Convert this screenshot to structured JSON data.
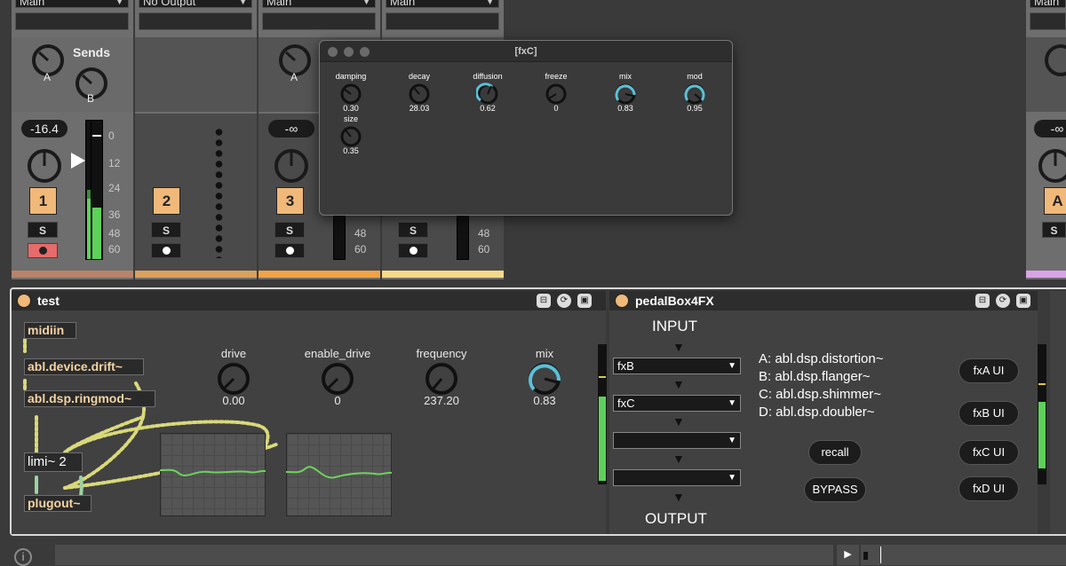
{
  "mixer": {
    "tracks": [
      {
        "output": "Main",
        "volume": "-16.4",
        "number": "1",
        "solo": "S"
      },
      {
        "output": "No Output",
        "number": "2",
        "solo": "S"
      },
      {
        "output": "Main",
        "volume": "-∞",
        "number": "3",
        "solo": "S"
      },
      {
        "output": "Main",
        "solo": "S"
      }
    ],
    "sends_label": "Sends",
    "send_a": "A",
    "send_b": "B",
    "scale": [
      "0",
      "12",
      "24",
      "36",
      "48",
      "60"
    ],
    "scale_partial": [
      "48",
      "60"
    ],
    "right_track": {
      "output": "Main",
      "volume": "-∞",
      "letter": "A",
      "solo": "S"
    },
    "colors": {
      "track1": "#b8836a",
      "track2": "#d9a15e",
      "track3": "#f0a347",
      "track4": "#f5d98b",
      "right": "#d9a3e8"
    }
  },
  "fxc_window": {
    "title": "[fxC]",
    "params": [
      {
        "label": "damping",
        "value": "0.30"
      },
      {
        "label": "decay",
        "value": "28.03"
      },
      {
        "label": "diffusion",
        "value": "0.62"
      },
      {
        "label": "freeze",
        "value": "0"
      },
      {
        "label": "mix",
        "value": "0.83"
      },
      {
        "label": "mod",
        "value": "0.95"
      },
      {
        "label": "size",
        "value": "0.35"
      }
    ]
  },
  "device_test": {
    "title": "test",
    "objects": [
      "midiin",
      "abl.device.drift~",
      "abl.dsp.ringmod~",
      "limi~ 2",
      "plugout~"
    ],
    "params": [
      {
        "label": "drive",
        "value": "0.00"
      },
      {
        "label": "enable_drive",
        "value": "0"
      },
      {
        "label": "frequency",
        "value": "237.20"
      },
      {
        "label": "mix",
        "value": "0.83"
      }
    ]
  },
  "device_pedal": {
    "title": "pedalBox4FX",
    "input_label": "INPUT",
    "output_label": "OUTPUT",
    "slots": [
      "fxB",
      "fxC",
      "",
      ""
    ],
    "descriptions": [
      "A: abl.dsp.distortion~",
      "B: abl.dsp.flanger~",
      "C: abl.dsp.shimmer~",
      "D: abl.dsp.doubler~"
    ],
    "recall": "recall",
    "bypass": "BYPASS",
    "ui_buttons": [
      "fxA UI",
      "fxB UI",
      "fxC UI",
      "fxD UI"
    ]
  },
  "statusbar": {
    "info_icon": "i",
    "play_icon": "play-icon"
  }
}
